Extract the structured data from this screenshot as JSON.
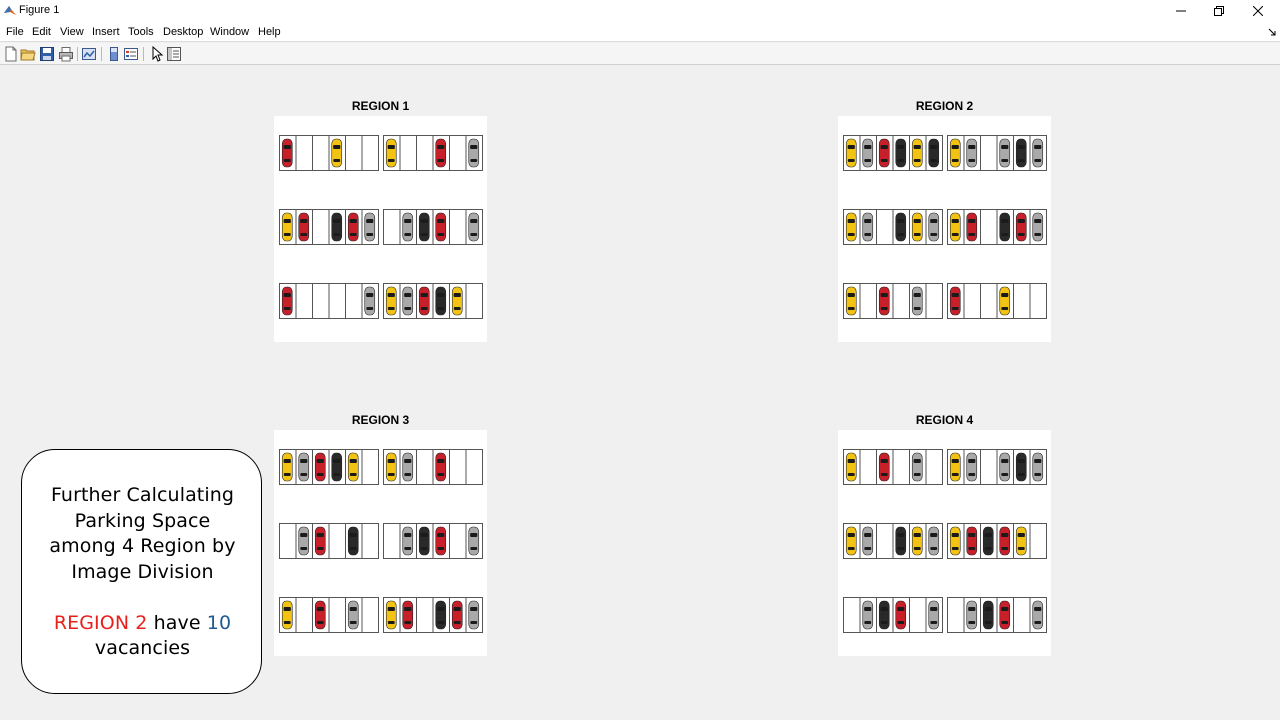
{
  "window": {
    "title": "Figure 1",
    "minimize_glyph": "—",
    "restore_glyph": "❐",
    "close_glyph": "✕",
    "resize_glyph": "↘"
  },
  "menu": [
    "File",
    "Edit",
    "View",
    "Insert",
    "Tools",
    "Desktop",
    "Window",
    "Help"
  ],
  "toolbar": [
    "new-figure-icon",
    "open-icon",
    "save-icon",
    "print-icon",
    "link-plot-icon",
    "insert-colorbar-icon",
    "insert-legend-icon",
    "edit-plot-icon",
    "property-inspector-icon"
  ],
  "colors": {
    "red": "#e8201c",
    "blue": "#1f5a93",
    "yellow": "#f2c313",
    "silver": "#a9a9a9",
    "black": "#2a2a2a",
    "car_red": "#c8202a"
  },
  "regions": [
    {
      "title": "REGION 1",
      "rows": [
        [
          "red",
          "",
          "",
          "yellow",
          "",
          "",
          "yellow",
          "",
          "",
          "red",
          "",
          "silver"
        ],
        [
          "yellow",
          "red",
          "",
          "black",
          "red",
          "silver",
          "",
          "silver",
          "black",
          "red",
          "",
          "silver"
        ],
        [
          "red",
          "",
          "",
          "",
          "",
          "silver",
          "yellow",
          "silver",
          "red",
          "black",
          "yellow",
          ""
        ]
      ]
    },
    {
      "title": "REGION 2",
      "rows": [
        [
          "yellow",
          "silver",
          "red",
          "black",
          "yellow",
          "black",
          "yellow",
          "silver",
          "",
          "silver",
          "black",
          "silver"
        ],
        [
          "yellow",
          "silver",
          "",
          "black",
          "yellow",
          "silver",
          "yellow",
          "red",
          "",
          "black",
          "red",
          "silver"
        ],
        [
          "yellow",
          "",
          "red",
          "",
          "silver",
          "",
          "red",
          "",
          "",
          "yellow",
          "",
          ""
        ]
      ]
    },
    {
      "title": "REGION 3",
      "rows": [
        [
          "yellow",
          "silver",
          "red",
          "black",
          "yellow",
          "",
          "yellow",
          "silver",
          "",
          "red",
          "",
          ""
        ],
        [
          "",
          "silver",
          "red",
          "",
          "black",
          "",
          "",
          "silver",
          "black",
          "red",
          "",
          "silver"
        ],
        [
          "yellow",
          "",
          "red",
          "",
          "silver",
          "",
          "yellow",
          "red",
          "",
          "black",
          "red",
          "silver"
        ]
      ]
    },
    {
      "title": "REGION 4",
      "rows": [
        [
          "yellow",
          "",
          "red",
          "",
          "silver",
          "",
          "yellow",
          "silver",
          "",
          "silver",
          "black",
          "silver"
        ],
        [
          "yellow",
          "silver",
          "",
          "black",
          "yellow",
          "silver",
          "yellow",
          "red",
          "black",
          "red",
          "yellow",
          ""
        ],
        [
          "",
          "silver",
          "black",
          "red",
          "",
          "silver",
          "",
          "silver",
          "black",
          "red",
          "",
          "silver"
        ]
      ]
    }
  ],
  "info": {
    "line1": "Further Calculating",
    "line2": "Parking Space",
    "line3": "among 4 Region by",
    "line4": "Image Division",
    "result_region": "REGION 2",
    "result_have": " have ",
    "result_count": "10",
    "line6": "vacancies"
  }
}
